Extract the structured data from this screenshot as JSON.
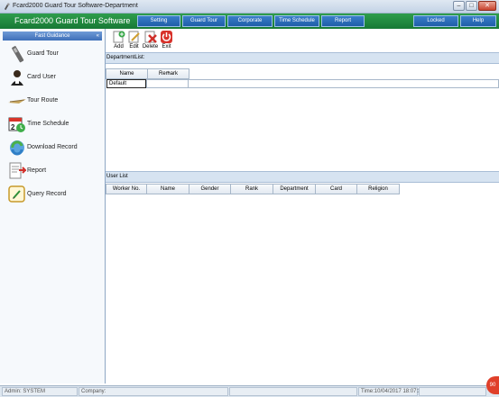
{
  "window": {
    "title": "Fcard2000 Guard Tour Software-Department",
    "min_glyph": "–",
    "max_glyph": "□",
    "close_glyph": "✕"
  },
  "menubar": {
    "brand": "Fcard2000 Guard Tour Software",
    "items": [
      "Setting",
      "Guard Tour",
      "Corporate",
      "Time Schedule",
      "Report"
    ],
    "locked": "Locked",
    "help": "Help",
    "color": "#1f8a40"
  },
  "sidebar": {
    "header": "Fast Guidance",
    "collapse_glyph": "«",
    "items": [
      {
        "label": "Guard Tour",
        "icon": "guard-tour-icon"
      },
      {
        "label": "Card User",
        "icon": "card-user-icon"
      },
      {
        "label": "Tour Route",
        "icon": "tour-route-icon"
      },
      {
        "label": "Time Schedule",
        "icon": "time-schedule-icon"
      },
      {
        "label": "Download Record",
        "icon": "download-record-icon"
      },
      {
        "label": "Report",
        "icon": "report-icon"
      },
      {
        "label": "Query Record",
        "icon": "query-record-icon"
      }
    ]
  },
  "toolbar": {
    "add": "Add",
    "edit": "Edit",
    "delete": "Delete",
    "exit": "Exit"
  },
  "department": {
    "title": "DepartmentList:",
    "columns": [
      "Name",
      "Remark"
    ],
    "rows": [
      {
        "name": "Default",
        "remark": ""
      }
    ]
  },
  "users": {
    "title": "User List",
    "columns": [
      "Worker No.",
      "Name",
      "Gender",
      "Rank",
      "Department",
      "Card",
      "Religion"
    ]
  },
  "status": {
    "admin": "Admin: SYSTEM",
    "company": "Company:",
    "time": "Time:10/04/2017 18:07:38",
    "badge": "90"
  }
}
